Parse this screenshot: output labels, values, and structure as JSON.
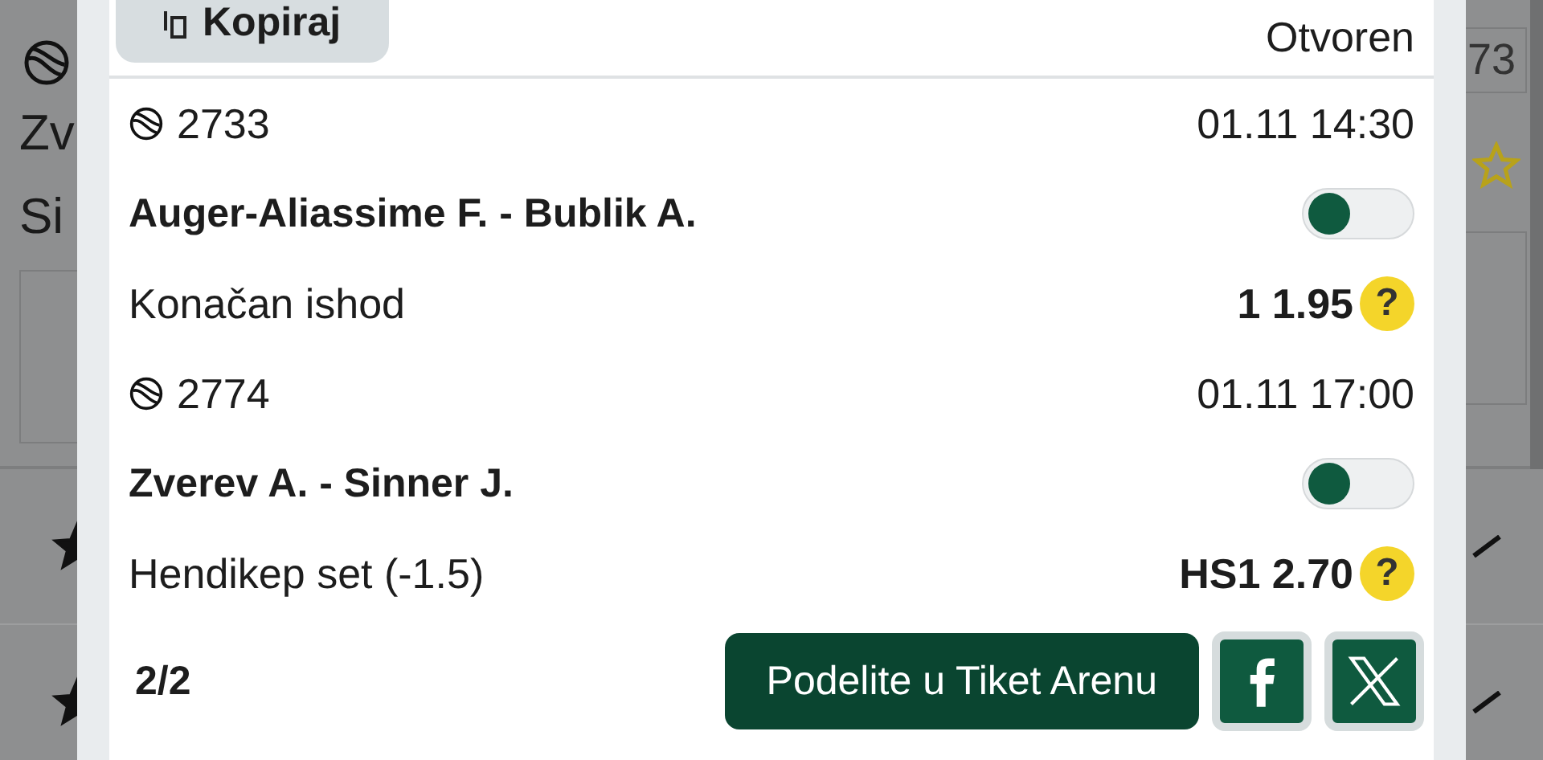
{
  "background": {
    "event_code": "73",
    "team_1": "Zv",
    "team_2": "Si",
    "rows": [
      {
        "starred": true
      },
      {
        "starred": true
      }
    ]
  },
  "dialog": {
    "copy_button": "Kopiraj",
    "status": "Otvoren",
    "bets": [
      {
        "code": "2733",
        "time": "01.11 14:30",
        "match": "Auger-Aliassime F. - Bublik A.",
        "on": false,
        "market": "Konačan ishod",
        "pick": "1 1.95",
        "help": "?"
      },
      {
        "code": "2774",
        "time": "01.11 17:00",
        "match": "Zverev A. - Sinner J.",
        "on": false,
        "market": "Hendikep set (-1.5)",
        "pick": "HS1 2.70",
        "help": "?"
      }
    ],
    "count": "2/2",
    "share_button": "Podelite u Tiket Arenu"
  }
}
